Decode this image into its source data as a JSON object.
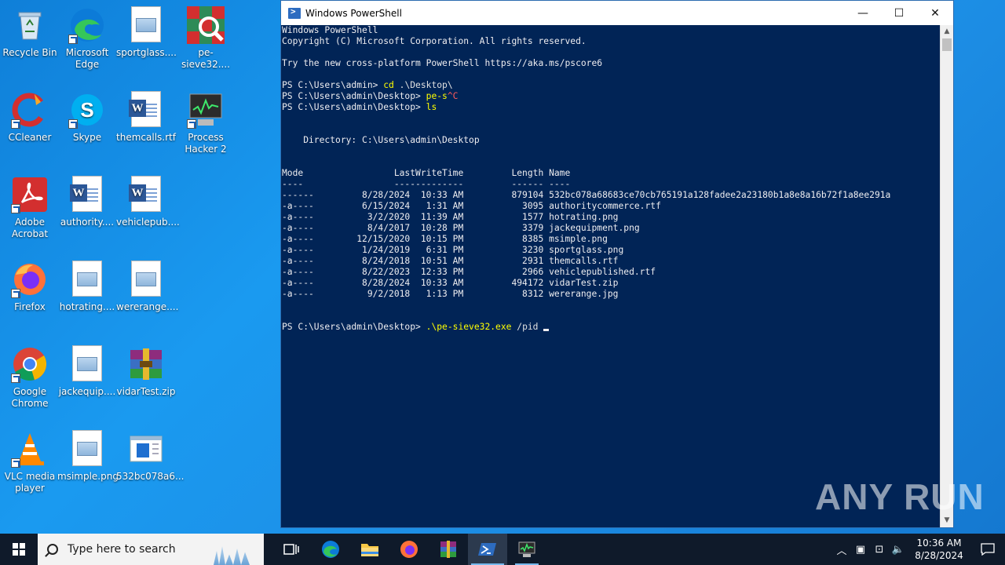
{
  "desktop": {
    "icons": [
      {
        "label": "Recycle Bin"
      },
      {
        "label": "Microsoft Edge"
      },
      {
        "label": "sportglass...."
      },
      {
        "label": "pe-sieve32...."
      },
      {
        "label": "CCleaner"
      },
      {
        "label": "Skype"
      },
      {
        "label": "themcalls.rtf"
      },
      {
        "label": "Process Hacker 2"
      },
      {
        "label": "Adobe Acrobat"
      },
      {
        "label": "authority...."
      },
      {
        "label": "vehiclepub...."
      },
      {
        "label": "Firefox"
      },
      {
        "label": "hotrating...."
      },
      {
        "label": "wererange...."
      },
      {
        "label": "Google Chrome"
      },
      {
        "label": "jackequip...."
      },
      {
        "label": "vidarTest.zip"
      },
      {
        "label": "VLC media player"
      },
      {
        "label": "msimple.png"
      },
      {
        "label": "532bc078a6..."
      }
    ]
  },
  "window": {
    "title": "Windows PowerShell",
    "minimize": "—",
    "maximize": "☐",
    "close": "✕"
  },
  "console": {
    "l1": "Windows PowerShell",
    "l2": "Copyright (C) Microsoft Corporation. All rights reserved.",
    "l3": "Try the new cross-platform PowerShell https://aka.ms/pscore6",
    "p1_prompt": "PS C:\\Users\\admin> ",
    "p1_cmd": "cd",
    "p1_arg": " .\\Desktop\\",
    "p2_prompt": "PS C:\\Users\\admin\\Desktop> ",
    "p2_cmd": "pe-s",
    "p2_err": "^C",
    "p3_prompt": "PS C:\\Users\\admin\\Desktop> ",
    "p3_cmd": "ls",
    "dir": "    Directory: C:\\Users\\admin\\Desktop",
    "hdr": "Mode                 LastWriteTime         Length Name",
    "sep": "----                 -------------         ------ ----",
    "rows": [
      "------         8/28/2024  10:33 AM         879104 532bc078a68683ce70cb765191a128fadee2a23180b1a8e8a16b72f1a8ee291a",
      "-a----         6/15/2024   1:31 AM           3095 authoritycommerce.rtf",
      "-a----          3/2/2020  11:39 AM           1577 hotrating.png",
      "-a----          8/4/2017  10:28 PM           3379 jackequipment.png",
      "-a----        12/15/2020  10:15 PM           8385 msimple.png",
      "-a----         1/24/2019   6:31 PM           3230 sportglass.png",
      "-a----         8/24/2018  10:51 AM           2931 themcalls.rtf",
      "-a----         8/22/2023  12:33 PM           2966 vehiclepublished.rtf",
      "-a----         8/28/2024  10:33 AM         494172 vidarTest.zip",
      "-a----          9/2/2018   1:13 PM           8312 wererange.jpg"
    ],
    "p4_prompt": "PS C:\\Users\\admin\\Desktop> ",
    "p4_cmd": ".\\pe-sieve32.exe",
    "p4_arg": " /pid "
  },
  "watermark": "ANY RUN",
  "taskbar": {
    "search_placeholder": "Type here to search",
    "clock_time": "10:36 AM",
    "clock_date": "8/28/2024"
  },
  "colors": {
    "console_bg": "#012456",
    "console_text": "#eeedf0",
    "command": "#ffff00",
    "error": "#ff5a5a",
    "desktop": "#1a9af0",
    "taskbar": "#0f1a2a"
  }
}
